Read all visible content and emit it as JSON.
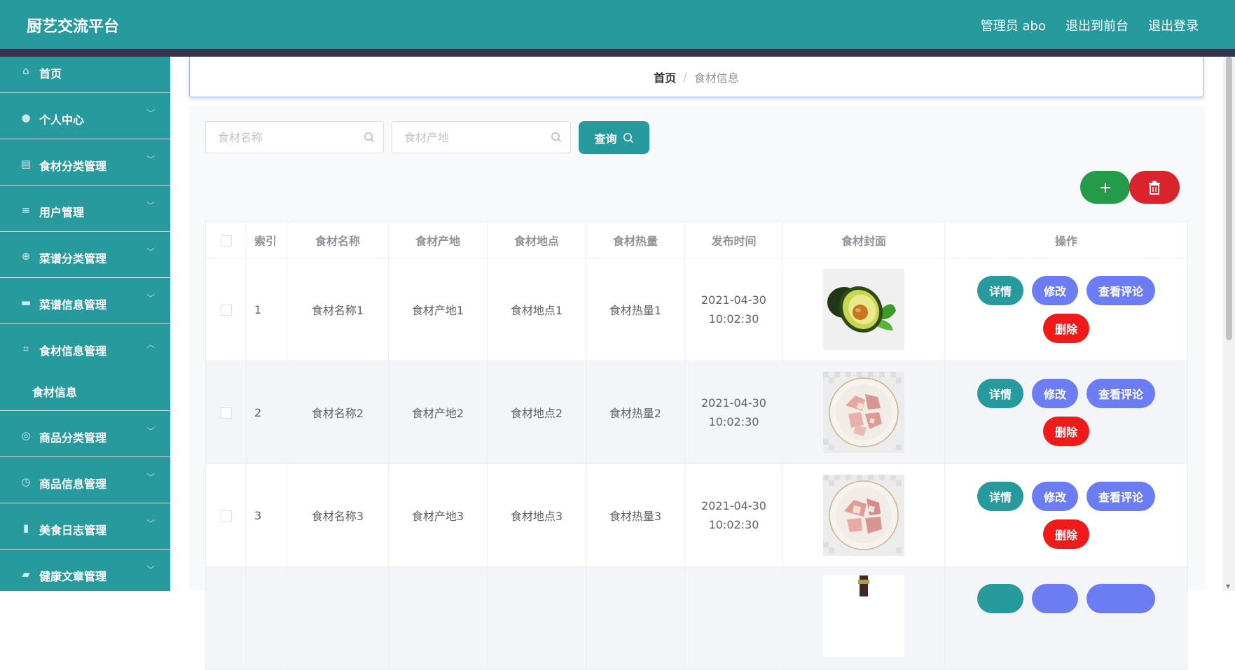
{
  "app": {
    "title": "厨艺交流平台"
  },
  "header": {
    "user_label": "管理员 abo",
    "front_link": "退出到前台",
    "logout_link": "退出登录"
  },
  "sidebar": {
    "items": [
      {
        "label": "首页",
        "icon": "home-icon",
        "glyph": "⌂"
      },
      {
        "label": "个人中心",
        "icon": "user-icon",
        "glyph": "●"
      },
      {
        "label": "食材分类管理",
        "icon": "clipboard-icon",
        "glyph": "▤"
      },
      {
        "label": "用户管理",
        "icon": "list-icon",
        "glyph": "≡"
      },
      {
        "label": "菜谱分类管理",
        "icon": "target-icon",
        "glyph": "⊕"
      },
      {
        "label": "菜谱信息管理",
        "icon": "monitor-icon",
        "glyph": "▬"
      },
      {
        "label": "食材信息管理",
        "icon": "crop-icon",
        "glyph": "⌗"
      },
      {
        "label": "商品分类管理",
        "icon": "compass-icon",
        "glyph": "◎"
      },
      {
        "label": "商品信息管理",
        "icon": "clock-icon",
        "glyph": "◷"
      },
      {
        "label": "美食日志管理",
        "icon": "chart-icon",
        "glyph": "▮"
      },
      {
        "label": "健康文章管理",
        "icon": "message-icon",
        "glyph": "▰"
      }
    ],
    "submenu_label": "食材信息"
  },
  "breadcrumb": {
    "home": "首页",
    "separator": "/",
    "current": "食材信息"
  },
  "search": {
    "name_placeholder": "食材名称",
    "origin_placeholder": "食材产地",
    "query_label": "查询"
  },
  "table": {
    "headers": {
      "index": "索引",
      "name": "食材名称",
      "origin": "食材产地",
      "location": "食材地点",
      "calories": "食材热量",
      "time": "发布时间",
      "cover": "食材封面",
      "actions": "操作"
    },
    "rows": [
      {
        "index": "1",
        "name": "食材名称1",
        "origin": "食材产地1",
        "location": "食材地点1",
        "calories": "食材热量1",
        "time": "2021-04-30 10:02:30",
        "cover": "avocado"
      },
      {
        "index": "2",
        "name": "食材名称2",
        "origin": "食材产地2",
        "location": "食材地点2",
        "calories": "食材热量2",
        "time": "2021-04-30 10:02:30",
        "cover": "chicken-plate"
      },
      {
        "index": "3",
        "name": "食材名称3",
        "origin": "食材产地3",
        "location": "食材地点3",
        "calories": "食材热量3",
        "time": "2021-04-30 10:02:30",
        "cover": "chicken-plate"
      }
    ],
    "actions": {
      "detail": "详情",
      "edit": "修改",
      "comments": "查看评论",
      "delete": "删除"
    }
  },
  "colors": {
    "primary": "#279a9d",
    "header_dark": "#33344d",
    "edit": "#6c7cf3",
    "danger": "#ef1b1b",
    "add": "#239b49",
    "batch_delete": "#d9232d"
  }
}
